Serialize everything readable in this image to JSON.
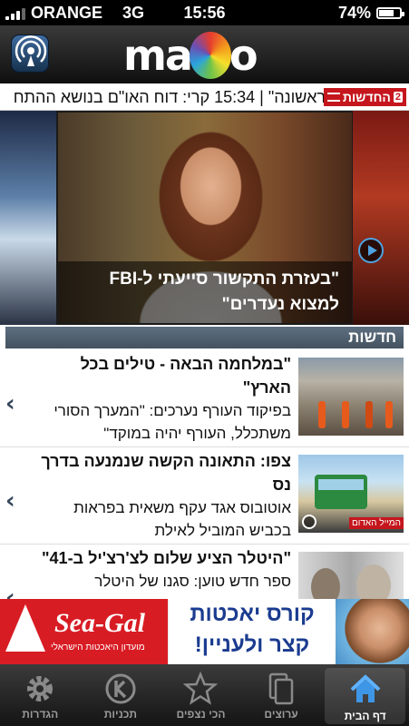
{
  "status": {
    "carrier": "ORANGE",
    "network": "3G",
    "time": "15:56",
    "battery": "74%",
    "battery_level": 0.74
  },
  "header": {
    "logo": "mako",
    "live_button_icon": "broadcast-icon"
  },
  "ticker": {
    "text": "ראשונה\"   |   15:34 קרי: דוח האו\"ם בנושא ההתח",
    "badge_label": "החדשות",
    "badge_num": "2"
  },
  "hero": {
    "caption": "\"בעזרת התקשור סייעתי ל-FBI למצוא נעדרים\""
  },
  "section": {
    "title": "חדשות"
  },
  "articles": [
    {
      "headline": "\"במלחמה הבאה - טילים בכל הארץ\"",
      "summary": "בפיקוד העורף נערכים: \"המערך הסורי משתכלל, העורף יהיה במוקד\""
    },
    {
      "headline": "צפו: התאונה הקשה שנמנעה בדרך נס",
      "summary": "אוטובוס אגד עקף משאית בפראות בכביש המוביל לאילת",
      "thumb_tag": "המייל האדום"
    },
    {
      "headline": "\"היטלר הציע שלום לצ'רצ'יל ב-41\"",
      "summary": "ספר חדש טוען: סגנו של היטלר"
    }
  ],
  "ad": {
    "brand": "Sea-Gal",
    "brand_sub": "מועדון היאכטות הישראלי",
    "line1": "קורס יאכטות",
    "line2": "קצר ולעניין!"
  },
  "tabs": [
    {
      "label": "הגדרות",
      "icon": "gear-icon"
    },
    {
      "label": "תכניות",
      "icon": "k-logo-icon"
    },
    {
      "label": "הכי נצפים",
      "icon": "star-icon"
    },
    {
      "label": "ערוצים",
      "icon": "channels-icon"
    },
    {
      "label": "דף הבית",
      "icon": "home-icon"
    }
  ],
  "colors": {
    "accent_red": "#c5161d",
    "section_bar": "#4f5e6d",
    "ad_blue": "#1a3b8f"
  }
}
